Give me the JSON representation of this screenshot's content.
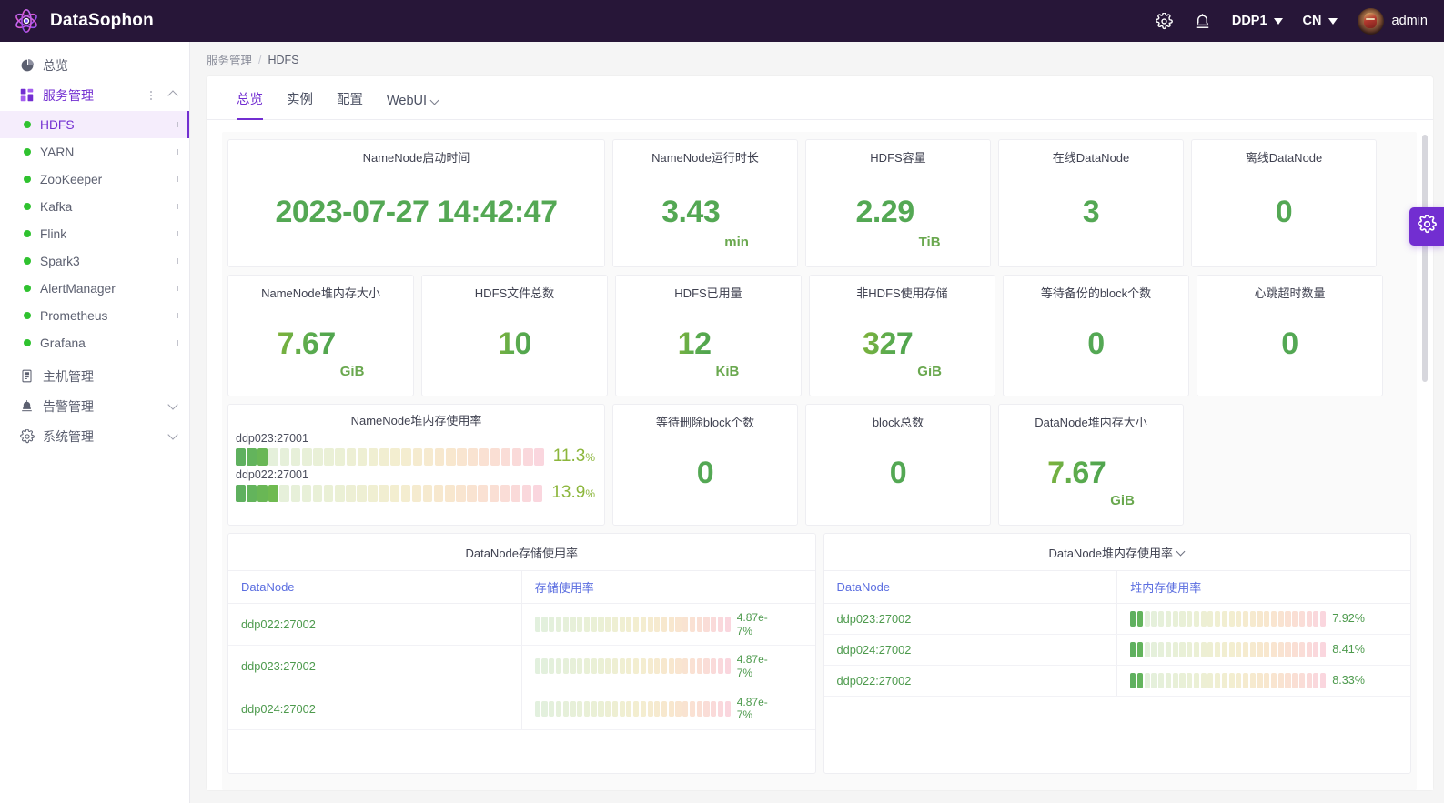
{
  "header": {
    "brand": "DataSophon",
    "brand_logo_icon": "atom-icon",
    "settings_icon": "gear-icon",
    "alarm_icon": "alarm-bell-icon",
    "cluster_label": "DDP1",
    "lang_label": "CN",
    "user_name": "admin",
    "avatar_icon": "user-avatar"
  },
  "sidebar": {
    "overview": {
      "label": "总览",
      "icon": "dashboard-icon"
    },
    "service_mgmt": {
      "label": "服务管理",
      "icon": "grid-icon"
    },
    "services": [
      {
        "label": "HDFS",
        "status": "green",
        "selected": true
      },
      {
        "label": "YARN",
        "status": "green",
        "selected": false
      },
      {
        "label": "ZooKeeper",
        "status": "green",
        "selected": false
      },
      {
        "label": "Kafka",
        "status": "green",
        "selected": false
      },
      {
        "label": "Flink",
        "status": "green",
        "selected": false
      },
      {
        "label": "Spark3",
        "status": "green",
        "selected": false
      },
      {
        "label": "AlertManager",
        "status": "green",
        "selected": false
      },
      {
        "label": "Prometheus",
        "status": "green",
        "selected": false
      },
      {
        "label": "Grafana",
        "status": "green",
        "selected": false
      }
    ],
    "host_mgmt": {
      "label": "主机管理",
      "icon": "server-icon"
    },
    "alert_mgmt": {
      "label": "告警管理",
      "icon": "alarm-bell-icon"
    },
    "system_mgmt": {
      "label": "系统管理",
      "icon": "gear-icon"
    }
  },
  "breadcrumb": {
    "parent": "服务管理",
    "separator": "/",
    "current": "HDFS"
  },
  "tabs": [
    {
      "label": "总览",
      "active": true
    },
    {
      "label": "实例",
      "active": false
    },
    {
      "label": "配置",
      "active": false
    },
    {
      "label": "WebUI",
      "active": false,
      "has_dropdown": true
    }
  ],
  "metrics_row1": [
    {
      "title": "NameNode启动时间",
      "value": "2023-07-27 14:42:47",
      "unit": ""
    },
    {
      "title": "NameNode运行时长",
      "value": "3.43",
      "unit": "min"
    },
    {
      "title": "HDFS容量",
      "value": "2.29",
      "unit": "TiB"
    },
    {
      "title": "在线DataNode",
      "value": "3",
      "unit": ""
    },
    {
      "title": "离线DataNode",
      "value": "0",
      "unit": ""
    }
  ],
  "metrics_row2": [
    {
      "title": "NameNode堆内存大小",
      "value": "7.67",
      "unit": "GiB"
    },
    {
      "title": "HDFS文件总数",
      "value": "10",
      "unit": ""
    },
    {
      "title": "HDFS已用量",
      "value": "12",
      "unit": "KiB"
    },
    {
      "title": "非HDFS使用存储",
      "value": "327",
      "unit": "GiB"
    },
    {
      "title": "等待备份的block个数",
      "value": "0",
      "unit": ""
    },
    {
      "title": "心跳超时数量",
      "value": "0",
      "unit": ""
    }
  ],
  "namenode_heap_gauge": {
    "title": "NameNode堆内存使用率",
    "segments_total": 28,
    "rows": [
      {
        "label": "ddp023:27001",
        "percent_text": "11.3",
        "percent_suffix": "%",
        "percent": 11.3
      },
      {
        "label": "ddp022:27001",
        "percent_text": "13.9",
        "percent_suffix": "%",
        "percent": 13.9
      }
    ]
  },
  "metrics_row3": [
    {
      "title": "等待删除block个数",
      "value": "0",
      "unit": ""
    },
    {
      "title": "block总数",
      "value": "0",
      "unit": ""
    },
    {
      "title": "DataNode堆内存大小",
      "value": "7.67",
      "unit": "GiB"
    }
  ],
  "table_storage": {
    "title": "DataNode存储使用率",
    "columns": [
      "DataNode",
      "存储使用率"
    ],
    "segments_total": 28,
    "rows": [
      {
        "node": "ddp022:27002",
        "value": "4.87e-7%",
        "percent": 5e-07
      },
      {
        "node": "ddp023:27002",
        "value": "4.87e-7%",
        "percent": 5e-07
      },
      {
        "node": "ddp024:27002",
        "value": "4.87e-7%",
        "percent": 5e-07
      }
    ]
  },
  "table_heap": {
    "title": "DataNode堆内存使用率",
    "has_dropdown": true,
    "columns": [
      "DataNode",
      "堆内存使用率"
    ],
    "segments_total": 28,
    "rows": [
      {
        "node": "ddp023:27002",
        "value": "7.92%",
        "percent": 7.92
      },
      {
        "node": "ddp024:27002",
        "value": "8.41%",
        "percent": 8.41
      },
      {
        "node": "ddp022:27002",
        "value": "8.33%",
        "percent": 8.33
      }
    ]
  },
  "fab": {
    "icon": "gear-icon"
  },
  "colors": {
    "brand_bg": "#271638",
    "accent": "#722ed1",
    "metric_green": "#54a854",
    "status_green": "#2fc22f",
    "link_blue": "#5b6ee0",
    "node_green": "#4d9a4d",
    "gauge_text": "#8cb63c"
  }
}
